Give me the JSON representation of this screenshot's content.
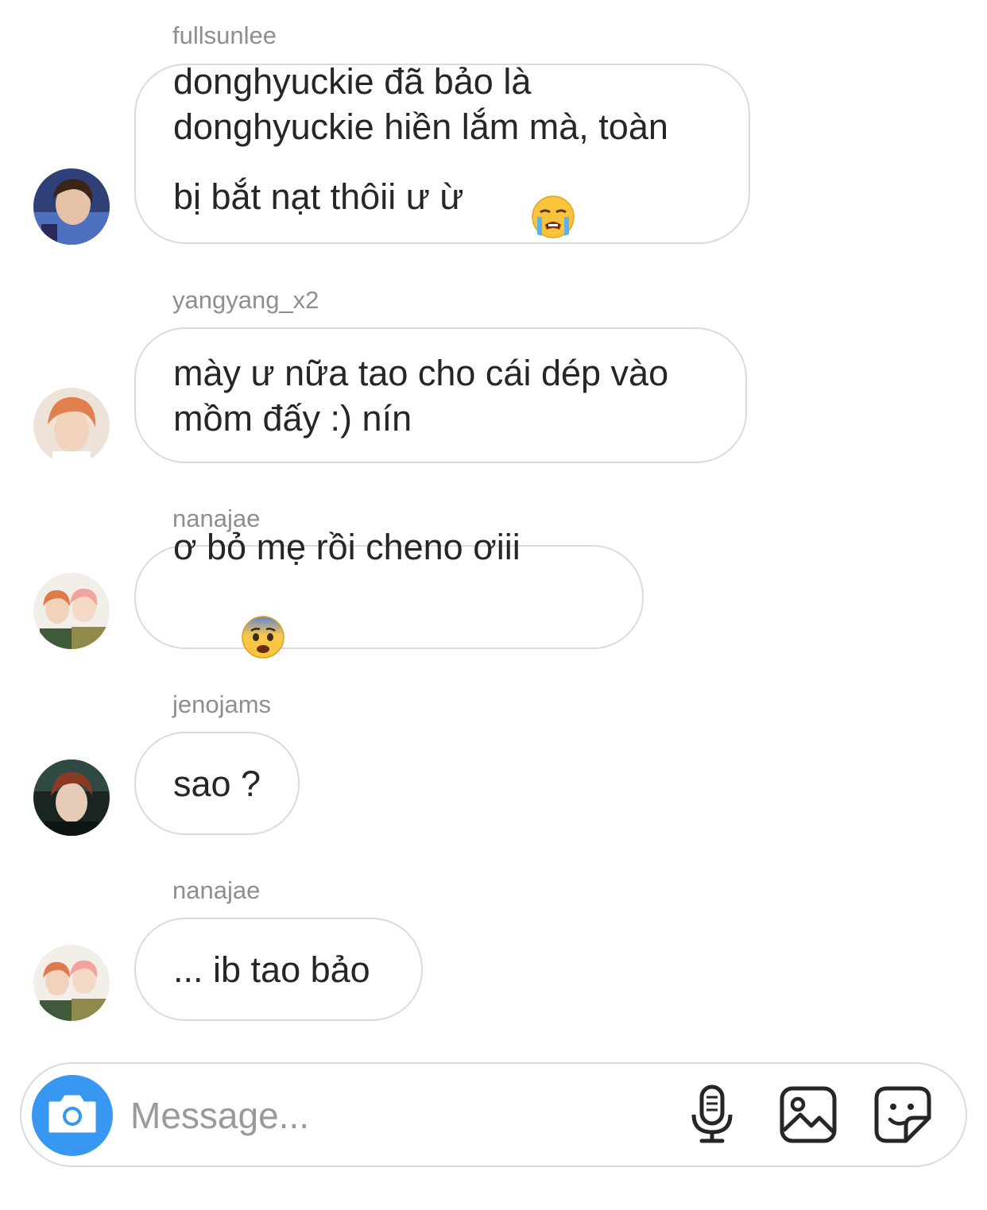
{
  "messages": [
    {
      "sender": "fullsunlee",
      "text": "donghyuckie đã bảo là\ndonghyuckie hiền lắm mà, toàn\nbị bắt nạt thôii ư ừ",
      "emoji": "loudly-crying-face"
    },
    {
      "sender": "yangyang_x2",
      "text": "mày ư nữa tao cho cái dép vào\nmồm đấy :) nín"
    },
    {
      "sender": "nanajae",
      "text": "ơ bỏ mẹ rồi cheno ơiii",
      "emoji": "anxious-face-with-sweat"
    },
    {
      "sender": "jenojams",
      "text": "sao ?"
    },
    {
      "sender": "nanajae",
      "text": "... ib tao bảo"
    }
  ],
  "composer": {
    "placeholder": "Message...",
    "icons": [
      "camera-icon",
      "microphone-icon",
      "gallery-icon",
      "sticker-icon"
    ],
    "accent_color": "#3897f0"
  }
}
